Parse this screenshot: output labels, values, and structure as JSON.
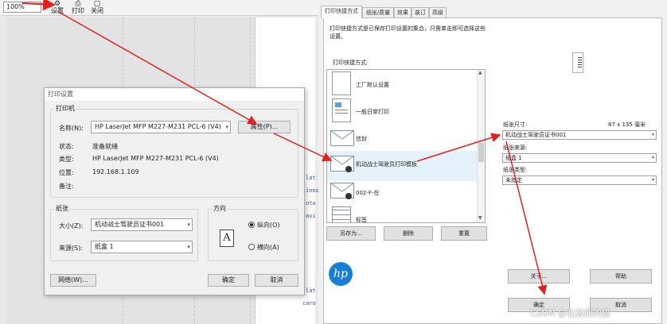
{
  "toolbar": {
    "zoom": "100%",
    "settings_label": "设置",
    "print_label": "打印",
    "close_label": "关闭"
  },
  "background_code": [
    "lat",
    "inno",
    "oto",
    "axi",
    "lat",
    "caro"
  ],
  "print_dialog": {
    "title": "打印设置",
    "printer_group": "打印机",
    "name_label": "名称(N):",
    "printer_name": "HP LaserJet MFP M227-M231 PCL-6 (V4)",
    "properties_button": "属性(P)...",
    "status_label": "状态:",
    "status_value": "准备就绪",
    "type_label": "类型:",
    "type_value": "HP LaserJet MFP M227-M231 PCL-6 (V4)",
    "location_label": "位置:",
    "location_value": "192.168.1.109",
    "comment_label": "备注:",
    "paper_group": "纸张",
    "size_label": "大小(Z):",
    "size_value": "机动战士驾驶员证书001",
    "source_label": "来源(S):",
    "source_value": "纸盒 1",
    "orientation_group": "方向",
    "portrait_label": "纵向(O)",
    "landscape_label": "横向(A)",
    "orientation_selected": "portrait",
    "network_button": "网络(W)...",
    "ok_button": "确定",
    "cancel_button": "取消"
  },
  "properties_dialog": {
    "tabs": [
      "打印快捷方式",
      "纸张/质量",
      "效果",
      "装订",
      "高级"
    ],
    "active_tab": 0,
    "description": "打印快捷方式是已保存打印设置的集合，只需单击即可选择这些设置。",
    "shortcuts_label": "打印快捷方式:",
    "shortcuts": [
      {
        "label": "工厂默认设置",
        "icon": "document-icon"
      },
      {
        "label": "一般日常打印",
        "icon": "document-color-icon"
      },
      {
        "label": "信封",
        "icon": "envelope-icon"
      },
      {
        "label": "机动战士驾驶员打印模板",
        "icon": "envelope-users-icon"
      },
      {
        "label": "002-F-在",
        "icon": "envelope-users-icon"
      },
      {
        "label": "标签",
        "icon": "label-sheet-icon"
      }
    ],
    "selected_shortcut": 3,
    "save_as_button": "另存为...",
    "delete_button": "删除",
    "reset_button": "重置",
    "paper_size_label": "纸张尺寸:",
    "paper_size_dims": "87 x 135 毫米",
    "paper_size_value": "机动战士驾驶员证书001",
    "paper_source_label": "纸张来源:",
    "paper_source_value": "纸盒 1",
    "paper_type_label": "纸张类型:",
    "paper_type_value": "未指定",
    "about_button": "关于...",
    "help_button": "帮助",
    "ok_button": "确定",
    "cancel_button": "取消",
    "logo": "hp"
  },
  "watermark": "CSDN @北极熊的狐",
  "colors": {
    "annotation_arrow": "#e02020",
    "hp_blue": "#1a7fd4",
    "selection": "#e5f1fb"
  }
}
